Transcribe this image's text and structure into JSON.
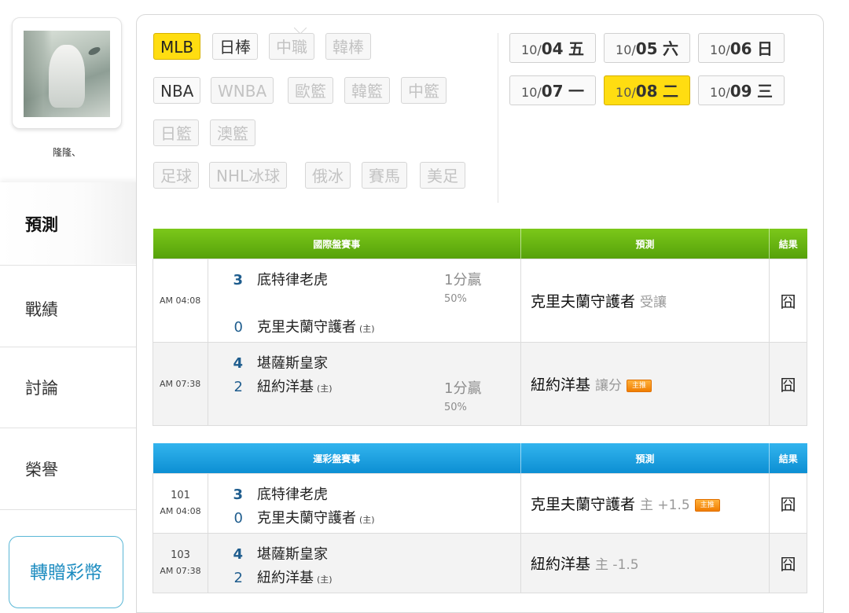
{
  "user": {
    "name": "隆隆、"
  },
  "nav": [
    "預測",
    "戰績",
    "討論",
    "榮譽"
  ],
  "gift_button": "轉贈彩幣",
  "sports": {
    "row1": [
      {
        "label": "MLB",
        "state": "selected"
      },
      {
        "label": "日棒",
        "state": "normal"
      },
      {
        "label": "中職",
        "state": "disabled"
      },
      {
        "label": "韓棒",
        "state": "disabled"
      }
    ],
    "row2": [
      {
        "label": "NBA",
        "state": "normal"
      },
      {
        "label": "WNBA",
        "state": "disabled"
      },
      {
        "label": "歐籃",
        "state": "disabled"
      },
      {
        "label": "韓籃",
        "state": "disabled"
      },
      {
        "label": "中籃",
        "state": "disabled"
      }
    ],
    "row3": [
      {
        "label": "日籃",
        "state": "disabled"
      },
      {
        "label": "澳籃",
        "state": "disabled"
      }
    ],
    "row4": [
      {
        "label": "足球",
        "state": "disabled"
      },
      {
        "label": "NHL冰球",
        "state": "disabled"
      },
      {
        "label": "俄冰",
        "state": "disabled"
      },
      {
        "label": "賽馬",
        "state": "disabled"
      },
      {
        "label": "美足",
        "state": "disabled"
      }
    ]
  },
  "dates": [
    {
      "month": "10/",
      "day": "04",
      "weekday": "五",
      "selected": false
    },
    {
      "month": "10/",
      "day": "05",
      "weekday": "六",
      "selected": false
    },
    {
      "month": "10/",
      "day": "06",
      "weekday": "日",
      "selected": false
    },
    {
      "month": "10/",
      "day": "07",
      "weekday": "一",
      "selected": false
    },
    {
      "month": "10/",
      "day": "08",
      "weekday": "二",
      "selected": true
    },
    {
      "month": "10/",
      "day": "09",
      "weekday": "三",
      "selected": false
    }
  ],
  "intl_table": {
    "headers": [
      "國際盤賽事",
      "預測",
      "結果"
    ],
    "rows": [
      {
        "time": "AM 04:08",
        "away_score": "3",
        "away_team": "底特律老虎",
        "home_score": "0",
        "home_team": "克里夫蘭守護者",
        "home_tag": "(主)",
        "odds": "1分贏",
        "pct": "50%",
        "pick": "克里夫蘭守護者",
        "pick_note": "受讓",
        "badge": "",
        "result": "囧"
      },
      {
        "time": "AM 07:38",
        "away_score": "4",
        "away_team": "堪薩斯皇家",
        "home_score": "2",
        "home_team": "紐約洋基",
        "home_tag": "(主)",
        "odds": "1分贏",
        "pct": "50%",
        "pick": "紐約洋基",
        "pick_note": "讓分",
        "badge": "主推",
        "result": "囧"
      }
    ]
  },
  "lottery_table": {
    "headers": [
      "運彩盤賽事",
      "預測",
      "結果"
    ],
    "rows": [
      {
        "number": "101",
        "time": "AM 04:08",
        "away_score": "3",
        "away_team": "底特律老虎",
        "home_score": "0",
        "home_team": "克里夫蘭守護者",
        "home_tag": "(主)",
        "pick": "克里夫蘭守護者",
        "pick_note": "主 +1.5",
        "badge": "主推",
        "result": "囧"
      },
      {
        "number": "103",
        "time": "AM 07:38",
        "away_score": "4",
        "away_team": "堪薩斯皇家",
        "home_score": "2",
        "home_team": "紐約洋基",
        "home_tag": "(主)",
        "pick": "紐約洋基",
        "pick_note": "主 -1.5",
        "badge": "",
        "result": "囧"
      }
    ]
  }
}
